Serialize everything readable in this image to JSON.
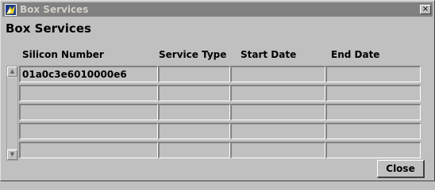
{
  "window": {
    "title": "Box Services",
    "close_glyph": "×"
  },
  "heading": "Box Services",
  "table": {
    "columns": [
      "Silicon Number",
      "Service Type",
      "Start Date",
      "End Date"
    ],
    "rows": [
      [
        "01a0c3e6010000e6",
        "",
        "",
        ""
      ],
      [
        "",
        "",
        "",
        ""
      ],
      [
        "",
        "",
        "",
        ""
      ],
      [
        "",
        "",
        "",
        ""
      ],
      [
        "",
        "",
        "",
        ""
      ]
    ]
  },
  "scrollbar": {
    "up_glyph": "▲",
    "down_glyph": "▼"
  },
  "buttons": {
    "close_label": "Close"
  },
  "colors": {
    "titlebar_inactive": "#808080",
    "window_bg": "#c0c0c0",
    "scroll_track": "#d8d8d8"
  }
}
